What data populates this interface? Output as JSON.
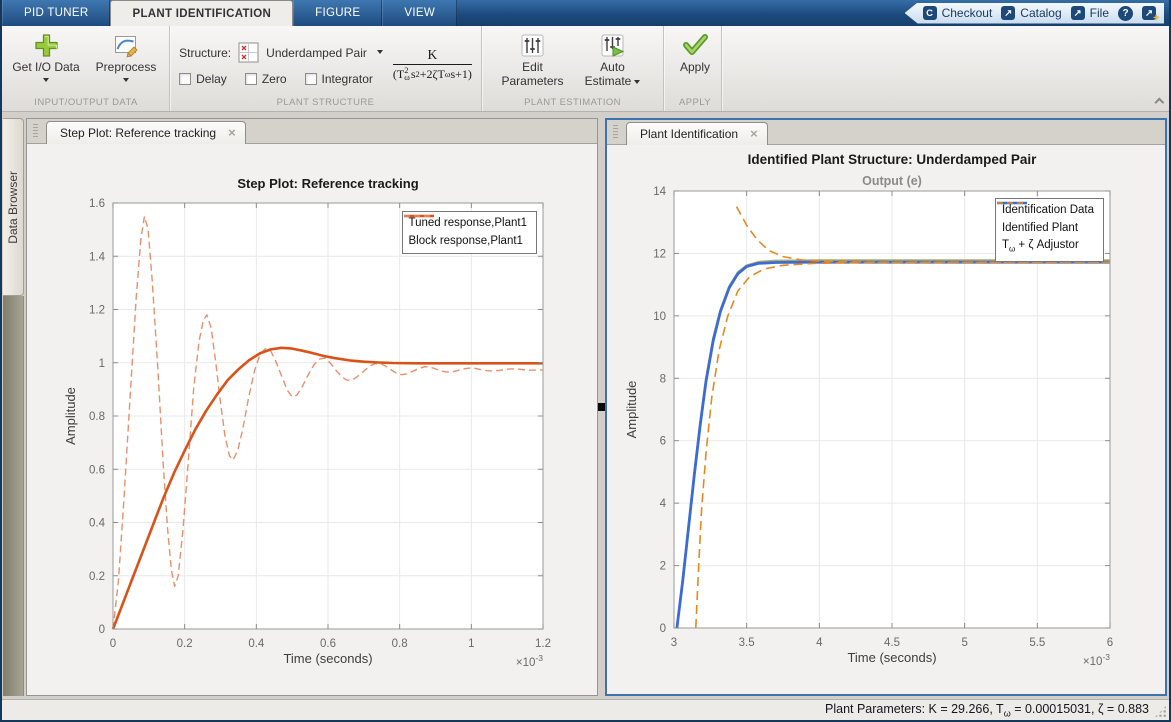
{
  "colors": {
    "tabbar_blue": "#1d4b7e",
    "active_panel_border": "#3e74ad",
    "matlab_orange": "#d95319",
    "identified_plant_blue": "#3b6bd5"
  },
  "tabbar": {
    "tabs": [
      {
        "label": "PID TUNER"
      },
      {
        "label": "PLANT IDENTIFICATION"
      },
      {
        "label": "FIGURE"
      },
      {
        "label": "VIEW"
      }
    ],
    "quick": {
      "checkout": "Checkout",
      "catalog": "Catalog",
      "file": "File",
      "icons": {
        "checkout": "C",
        "external": "↗",
        "help": "?",
        "plus": "+"
      }
    }
  },
  "ribbon": {
    "io": {
      "section": "INPUT/OUTPUT DATA",
      "get_io": "Get I/O Data",
      "preprocess": "Preprocess"
    },
    "structure": {
      "section": "PLANT STRUCTURE",
      "label": "Structure:",
      "value": "Underdamped Pair",
      "cb": [
        "Delay",
        "Zero",
        "Integrator"
      ],
      "formula": {
        "num": "K",
        "d1": "(T",
        "d1_sup": "2",
        "d1_sub": "ω",
        "d2": "s",
        "d2_sup": "2",
        "d3": "+2ζT",
        "d3_sub": "ω",
        "d4": "s+1)"
      }
    },
    "estimation": {
      "section": "PLANT ESTIMATION",
      "edit1": "Edit",
      "edit2": "Parameters",
      "auto1": "Auto",
      "auto2": "Estimate"
    },
    "apply": {
      "section": "APPLY",
      "label": "Apply"
    }
  },
  "data_browser": {
    "label": "Data Browser"
  },
  "left_panel": {
    "tab": "Step Plot: Reference tracking",
    "close": "×"
  },
  "right_panel": {
    "tab": "Plant Identification",
    "close": "×"
  },
  "status": {
    "p1": "Plant Parameters: K = 29.266, T",
    "sub": "ω",
    "p2": " = 0.00015031, ζ = 0.883"
  },
  "chart_data": [
    {
      "id": "left",
      "type": "line",
      "titles": [
        {
          "text": "Step Plot: Reference tracking",
          "dy": 44,
          "size": 13,
          "weight": "bold",
          "color": "#1a1a1a"
        }
      ],
      "xlabel": "Time (seconds)",
      "ylabel": "Amplitude",
      "multiplier": {
        "base": "×10",
        "exp": "-3"
      },
      "xlim": [
        0,
        1.2
      ],
      "ylim": [
        0,
        1.6
      ],
      "grid": true,
      "legend_position": "top-right",
      "margins": {
        "l": 86,
        "r": 54,
        "t": 59,
        "b": 66
      },
      "legend_offset": {
        "top": 8,
        "right": 6
      },
      "xticks": [
        {
          "v": 0,
          "l": "0"
        },
        {
          "v": 0.2,
          "l": "0.2"
        },
        {
          "v": 0.4,
          "l": "0.4"
        },
        {
          "v": 0.6,
          "l": "0.6"
        },
        {
          "v": 0.8,
          "l": "0.8"
        },
        {
          "v": 1,
          "l": "1"
        },
        {
          "v": 1.2,
          "l": "1.2"
        }
      ],
      "yticks": [
        {
          "v": 0,
          "l": "0"
        },
        {
          "v": 0.2,
          "l": "0.2"
        },
        {
          "v": 0.4,
          "l": "0.4"
        },
        {
          "v": 0.6,
          "l": "0.6"
        },
        {
          "v": 0.8,
          "l": "0.8"
        },
        {
          "v": 1,
          "l": "1"
        },
        {
          "v": 1.2,
          "l": "1.2"
        },
        {
          "v": 1.4,
          "l": "1.4"
        },
        {
          "v": 1.6,
          "l": "1.6"
        }
      ],
      "series": [
        {
          "name": "Block response,Plant1",
          "legend": {
            "p1": "Block response,Plant1"
          },
          "color": "#e8906c",
          "width": 1.4,
          "dash": "7,4",
          "legend_order": 2,
          "points": [
            [
              0,
              0
            ],
            [
              0.015,
              0.18
            ],
            [
              0.03,
              0.48
            ],
            [
              0.05,
              0.92
            ],
            [
              0.065,
              1.25
            ],
            [
              0.078,
              1.47
            ],
            [
              0.088,
              1.55
            ],
            [
              0.098,
              1.5
            ],
            [
              0.11,
              1.3
            ],
            [
              0.125,
              0.98
            ],
            [
              0.14,
              0.62
            ],
            [
              0.152,
              0.38
            ],
            [
              0.163,
              0.22
            ],
            [
              0.172,
              0.16
            ],
            [
              0.182,
              0.2
            ],
            [
              0.195,
              0.37
            ],
            [
              0.21,
              0.63
            ],
            [
              0.225,
              0.9
            ],
            [
              0.24,
              1.08
            ],
            [
              0.252,
              1.16
            ],
            [
              0.262,
              1.18
            ],
            [
              0.274,
              1.13
            ],
            [
              0.287,
              1.0
            ],
            [
              0.3,
              0.85
            ],
            [
              0.313,
              0.72
            ],
            [
              0.325,
              0.65
            ],
            [
              0.335,
              0.635
            ],
            [
              0.348,
              0.67
            ],
            [
              0.362,
              0.75
            ],
            [
              0.378,
              0.865
            ],
            [
              0.395,
              0.97
            ],
            [
              0.41,
              1.03
            ],
            [
              0.425,
              1.053
            ],
            [
              0.44,
              1.045
            ],
            [
              0.456,
              1.0
            ],
            [
              0.472,
              0.945
            ],
            [
              0.487,
              0.895
            ],
            [
              0.5,
              0.872
            ],
            [
              0.513,
              0.878
            ],
            [
              0.528,
              0.91
            ],
            [
              0.545,
              0.955
            ],
            [
              0.562,
              0.995
            ],
            [
              0.578,
              1.015
            ],
            [
              0.592,
              1.017
            ],
            [
              0.606,
              1.0
            ],
            [
              0.622,
              0.972
            ],
            [
              0.638,
              0.948
            ],
            [
              0.652,
              0.935
            ],
            [
              0.665,
              0.934
            ],
            [
              0.68,
              0.946
            ],
            [
              0.697,
              0.965
            ],
            [
              0.714,
              0.985
            ],
            [
              0.73,
              0.996
            ],
            [
              0.745,
              0.997
            ],
            [
              0.76,
              0.988
            ],
            [
              0.776,
              0.973
            ],
            [
              0.792,
              0.96
            ],
            [
              0.806,
              0.955
            ],
            [
              0.82,
              0.958
            ],
            [
              0.836,
              0.968
            ],
            [
              0.853,
              0.978
            ],
            [
              0.87,
              0.985
            ],
            [
              0.885,
              0.984
            ],
            [
              0.9,
              0.977
            ],
            [
              0.916,
              0.969
            ],
            [
              0.932,
              0.965
            ],
            [
              0.947,
              0.966
            ],
            [
              0.962,
              0.971
            ],
            [
              0.978,
              0.977
            ],
            [
              0.994,
              0.98
            ],
            [
              1.01,
              0.979
            ],
            [
              1.027,
              0.974
            ],
            [
              1.044,
              0.97
            ],
            [
              1.06,
              0.969
            ],
            [
              1.077,
              0.971
            ],
            [
              1.095,
              0.975
            ],
            [
              1.113,
              0.977
            ],
            [
              1.13,
              0.976
            ],
            [
              1.15,
              0.973
            ],
            [
              1.17,
              0.972
            ],
            [
              1.2,
              0.973
            ]
          ]
        },
        {
          "name": "Tuned response,Plant1",
          "legend": {
            "p1": "Tuned response,Plant1"
          },
          "color": "#d95319",
          "width": 2.6,
          "dash": null,
          "legend_order": 1,
          "points": [
            [
              0,
              0
            ],
            [
              0.02,
              0.07
            ],
            [
              0.05,
              0.175
            ],
            [
              0.08,
              0.28
            ],
            [
              0.11,
              0.385
            ],
            [
              0.14,
              0.49
            ],
            [
              0.17,
              0.585
            ],
            [
              0.2,
              0.67
            ],
            [
              0.23,
              0.75
            ],
            [
              0.26,
              0.82
            ],
            [
              0.29,
              0.88
            ],
            [
              0.32,
              0.935
            ],
            [
              0.35,
              0.975
            ],
            [
              0.38,
              1.01
            ],
            [
              0.41,
              1.035
            ],
            [
              0.44,
              1.05
            ],
            [
              0.47,
              1.056
            ],
            [
              0.5,
              1.053
            ],
            [
              0.53,
              1.045
            ],
            [
              0.56,
              1.035
            ],
            [
              0.59,
              1.025
            ],
            [
              0.62,
              1.017
            ],
            [
              0.66,
              1.009
            ],
            [
              0.7,
              1.004
            ],
            [
              0.74,
              1.001
            ],
            [
              0.78,
              0.999
            ],
            [
              0.85,
              0.998
            ],
            [
              0.95,
              0.998
            ],
            [
              1.05,
              0.998
            ],
            [
              1.2,
              0.998
            ]
          ]
        }
      ]
    },
    {
      "id": "right",
      "type": "line",
      "titles": [
        {
          "text": "Identified Plant Structure: Underdamped Pair",
          "dy": 19,
          "size": 13.5,
          "weight": "bold",
          "color": "#1a1a1a"
        },
        {
          "text": "Output (e)",
          "dy": 40,
          "size": 12.5,
          "weight": "bold",
          "color": "#8a8a8a"
        }
      ],
      "xlabel": "Time (seconds)",
      "ylabel": "Amplitude",
      "multiplier": {
        "base": "×10",
        "exp": "-3"
      },
      "xlim": [
        3,
        6
      ],
      "ylim": [
        0,
        14
      ],
      "grid": true,
      "legend_position": "top-right",
      "margins": {
        "l": 67,
        "r": 55,
        "t": 46,
        "b": 66
      },
      "legend_offset": {
        "top": 7,
        "right": 6
      },
      "xticks": [
        {
          "v": 3,
          "l": "3"
        },
        {
          "v": 3.5,
          "l": "3.5"
        },
        {
          "v": 4,
          "l": "4"
        },
        {
          "v": 4.5,
          "l": "4.5"
        },
        {
          "v": 5,
          "l": "5"
        },
        {
          "v": 5.5,
          "l": "5.5"
        },
        {
          "v": 6,
          "l": "6"
        }
      ],
      "yticks": [
        {
          "v": 0,
          "l": "0"
        },
        {
          "v": 2,
          "l": "2"
        },
        {
          "v": 4,
          "l": "4"
        },
        {
          "v": 6,
          "l": "6"
        },
        {
          "v": 8,
          "l": "8"
        },
        {
          "v": 10,
          "l": "10"
        },
        {
          "v": 12,
          "l": "12"
        },
        {
          "v": 14,
          "l": "14"
        }
      ],
      "series": [
        {
          "name": "Identification Data",
          "legend": {
            "p1": "Identification Data"
          },
          "color": "#a9ad6f",
          "width": 2,
          "dash": null,
          "legend_order": 1,
          "points": [
            [
              3.02,
              0
            ],
            [
              3.06,
              1.6
            ],
            [
              3.1,
              3.3
            ],
            [
              3.14,
              5.0
            ],
            [
              3.18,
              6.6
            ],
            [
              3.22,
              8.0
            ],
            [
              3.27,
              9.3
            ],
            [
              3.32,
              10.2
            ],
            [
              3.38,
              10.95
            ],
            [
              3.44,
              11.4
            ],
            [
              3.5,
              11.62
            ],
            [
              3.58,
              11.73
            ],
            [
              3.7,
              11.77
            ],
            [
              4.0,
              11.78
            ],
            [
              6.0,
              11.78
            ]
          ]
        },
        {
          "name": "Identified Plant",
          "legend": {
            "p1": "Identified Plant"
          },
          "color": "#3b6bd5",
          "width": 2.8,
          "dash": null,
          "legend_order": 2,
          "points": [
            [
              3.02,
              0
            ],
            [
              3.06,
              1.5
            ],
            [
              3.1,
              3.2
            ],
            [
              3.14,
              4.9
            ],
            [
              3.18,
              6.5
            ],
            [
              3.22,
              7.9
            ],
            [
              3.27,
              9.2
            ],
            [
              3.32,
              10.15
            ],
            [
              3.38,
              10.9
            ],
            [
              3.44,
              11.35
            ],
            [
              3.5,
              11.58
            ],
            [
              3.58,
              11.68
            ],
            [
              3.7,
              11.71
            ],
            [
              3.9,
              11.72
            ],
            [
              6.0,
              11.72
            ]
          ]
        },
        {
          "name": "Tw + z Adjustor",
          "legend": {
            "p1": "T",
            "sub": "ω",
            "p2": " + ζ Adjustor"
          },
          "color": "#e5891f",
          "width": 1.6,
          "dash": "9,5",
          "legend_order": 3,
          "segments": [
            [
              [
                3.15,
                0
              ],
              [
                3.17,
                2.0
              ],
              [
                3.19,
                3.8
              ],
              [
                3.22,
                5.6
              ],
              [
                3.26,
                7.4
              ],
              [
                3.31,
                8.9
              ],
              [
                3.37,
                10.0
              ],
              [
                3.44,
                10.8
              ],
              [
                3.52,
                11.25
              ],
              [
                3.62,
                11.5
              ],
              [
                3.75,
                11.62
              ],
              [
                3.95,
                11.68
              ],
              [
                4.3,
                11.71
              ],
              [
                6.0,
                11.72
              ]
            ],
            [
              [
                3.43,
                13.5
              ],
              [
                3.5,
                12.9
              ],
              [
                3.57,
                12.45
              ],
              [
                3.65,
                12.1
              ],
              [
                3.75,
                11.9
              ],
              [
                3.88,
                11.79
              ],
              [
                4.05,
                11.74
              ],
              [
                4.4,
                11.72
              ],
              [
                6.0,
                11.72
              ]
            ]
          ]
        }
      ]
    }
  ]
}
